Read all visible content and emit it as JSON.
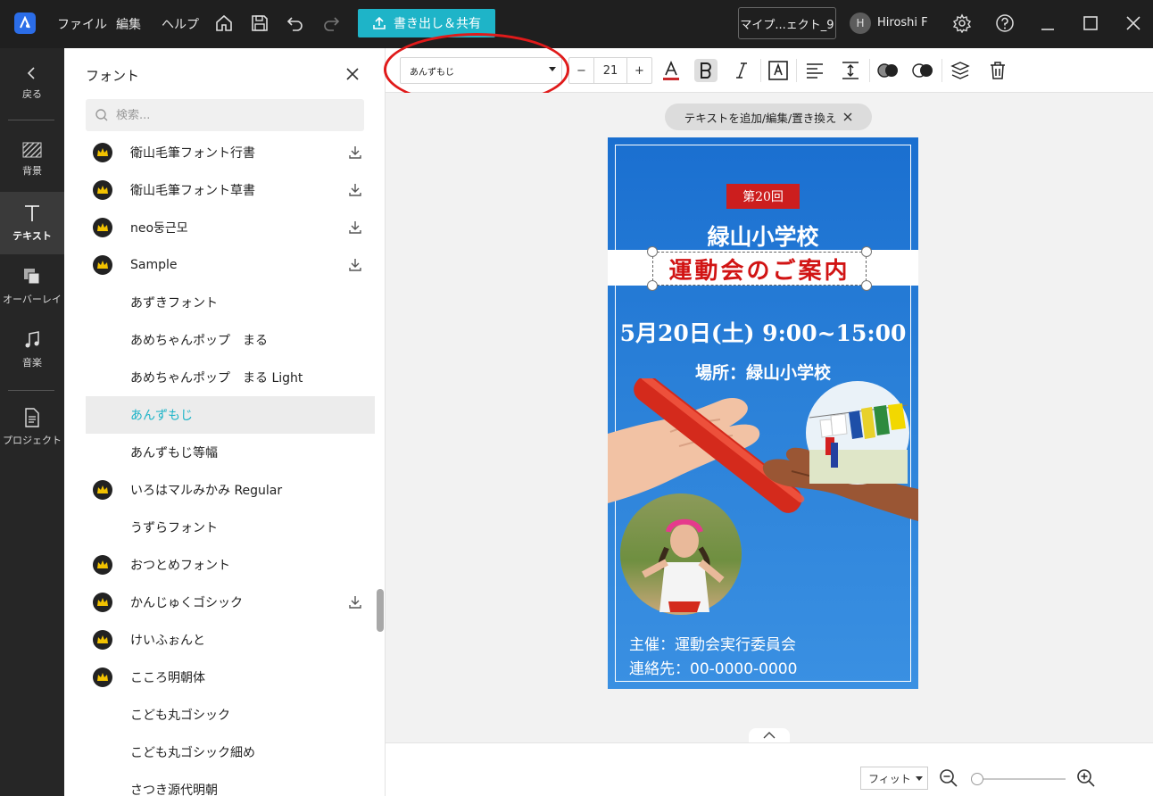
{
  "titlebar": {
    "menu": [
      "ファイル",
      "編集",
      "ヘルプ"
    ],
    "export_label": "書き出し＆共有",
    "project_name": "マイプ...ェクト_9",
    "user_initial": "H",
    "user_name": "Hiroshi F"
  },
  "rail": {
    "back": "戻る",
    "background": "背景",
    "text": "テキスト",
    "overlay": "オーバーレイ",
    "music": "音楽",
    "project": "プロジェクト",
    "active": "text"
  },
  "font_panel": {
    "title": "フォント",
    "search_placeholder": "検索...",
    "fonts": [
      {
        "name": "衛山毛筆フォント行書",
        "premium": true,
        "download": true
      },
      {
        "name": "衛山毛筆フォント草書",
        "premium": true,
        "download": true
      },
      {
        "name": "neo둥근모",
        "premium": true,
        "download": true
      },
      {
        "name": "Sample",
        "premium": true,
        "download": true
      },
      {
        "name": "あずきフォント",
        "premium": false,
        "download": false
      },
      {
        "name": "あめちゃんポップ　まる",
        "premium": false,
        "download": false
      },
      {
        "name": "あめちゃんポップ　まる Light",
        "premium": false,
        "download": false
      },
      {
        "name": "あんずもじ",
        "premium": false,
        "download": false,
        "selected": true
      },
      {
        "name": "あんずもじ等幅",
        "premium": false,
        "download": false
      },
      {
        "name": "いろはマルみかみ Regular",
        "premium": true,
        "download": false
      },
      {
        "name": "うずらフォント",
        "premium": false,
        "download": false
      },
      {
        "name": "おつとめフォント",
        "premium": true,
        "download": false
      },
      {
        "name": "かんじゅくゴシック",
        "premium": true,
        "download": true
      },
      {
        "name": "けいふぉんと",
        "premium": true,
        "download": false
      },
      {
        "name": "こころ明朝体",
        "premium": true,
        "download": false
      },
      {
        "name": "こども丸ゴシック",
        "premium": false,
        "download": false
      },
      {
        "name": "こども丸ゴシック細め",
        "premium": false,
        "download": false
      },
      {
        "name": "さつき源代明朝",
        "premium": false,
        "download": false
      }
    ]
  },
  "toolbar": {
    "font_value": "あんずもじ",
    "font_size": "21",
    "minus": "−",
    "plus": "+"
  },
  "canvas": {
    "hint": "テキストを追加/編集/置き換え"
  },
  "poster": {
    "badge": "第20回",
    "school": "緑山小学校",
    "event_title": "運動会のご案内",
    "date": "5月20日(土) 9:00~15:00",
    "venue": "場所：緑山小学校",
    "organizer": "主催：運動会実行委員会",
    "contact": "連絡先：00-0000-0000"
  },
  "bottombar": {
    "zoom_label": "フィット",
    "zoom_level": 0.05
  },
  "colors": {
    "accent": "#1eb4c8",
    "annotation": "#e01a1a",
    "poster_blue": "#1a6fd0",
    "title_red": "#d11414"
  }
}
